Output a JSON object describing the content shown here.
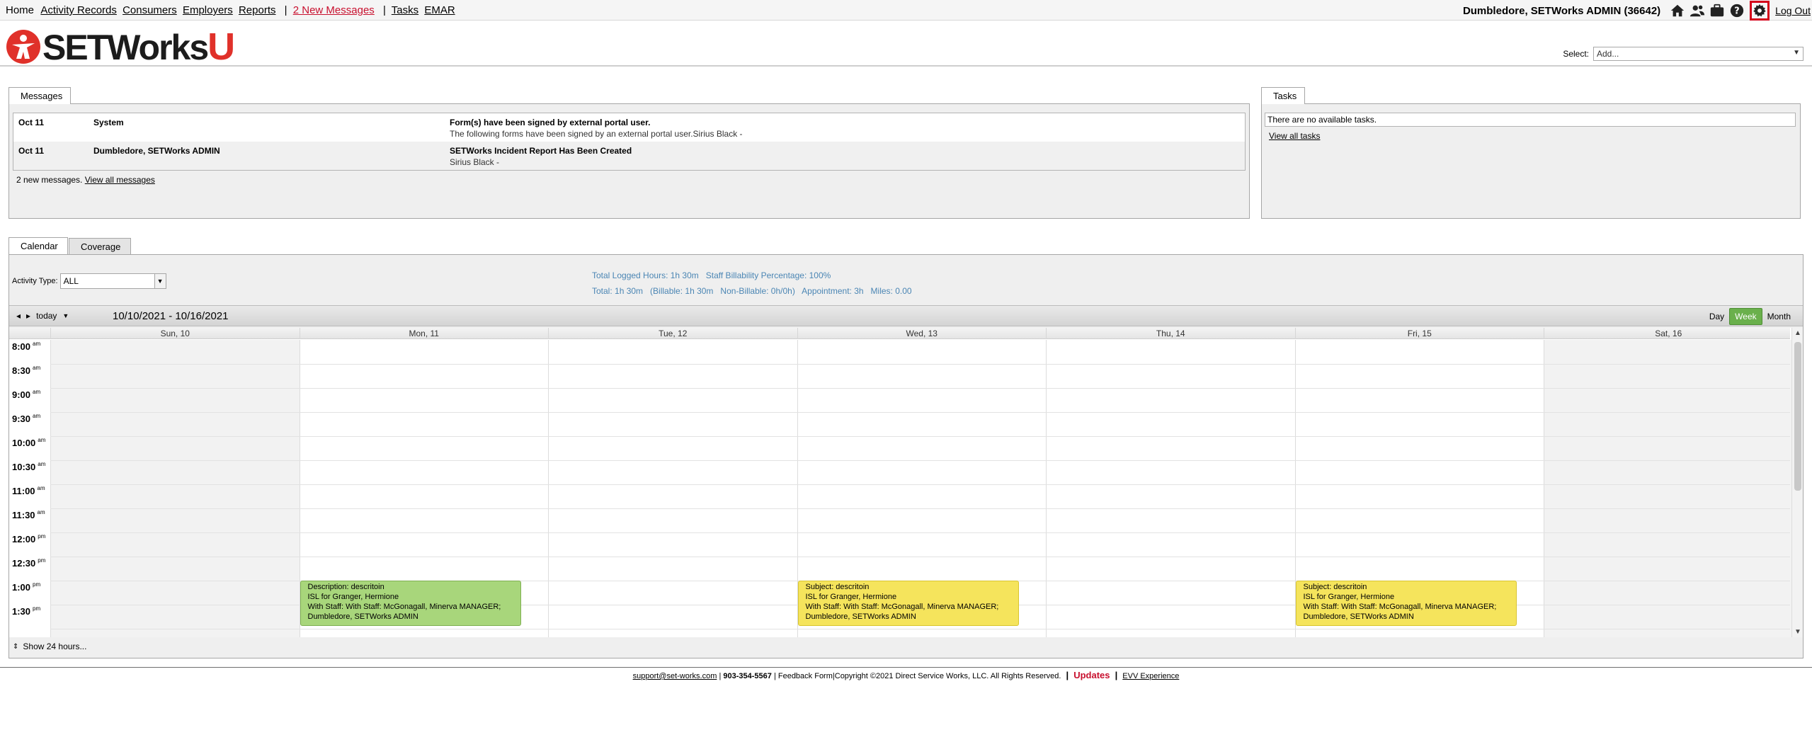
{
  "nav": {
    "home": "Home",
    "links": [
      "Activity Records",
      "Consumers",
      "Employers",
      "Reports"
    ],
    "messages": "2 New Messages",
    "tasks": "Tasks",
    "emar": "EMAR",
    "user": "Dumbledore,  SETWorks ADMIN  (36642)",
    "logout": "Log Out"
  },
  "logo": {
    "text": "SETWorks",
    "u": "U"
  },
  "quick_select": {
    "label": "Select:",
    "value": "Add..."
  },
  "messages": {
    "tab": "Messages",
    "rows": [
      {
        "date": "Oct 11",
        "from": "System",
        "subject": "Form(s) have been signed by external portal user.",
        "body": "The following forms have been signed by an external portal user.Sirius Black -"
      },
      {
        "date": "Oct 11",
        "from": "Dumbledore, SETWorks ADMIN",
        "subject": "SETWorks Incident Report Has Been Created",
        "body": "Sirius Black -"
      }
    ],
    "summary": "2 new messages.",
    "view_all": "View all messages"
  },
  "tasks": {
    "tab": "Tasks",
    "empty": "There are no available tasks.",
    "view_all": "View all tasks"
  },
  "calendar": {
    "tabs": [
      "Calendar",
      "Coverage"
    ],
    "activity_type_label": "Activity Type:",
    "activity_type_value": "ALL",
    "stats_line1": "Total Logged Hours: 1h 30m   Staff Billability Percentage: 100%",
    "stats_line2": "Total: 1h 30m   (Billable: 1h 30m   Non-Billable: 0h/0h)   Appointment: 3h   Miles: 0.00",
    "today": "today",
    "range": "10/10/2021 - 10/16/2021",
    "views": [
      "Day",
      "Week",
      "Month"
    ],
    "days": [
      "Sun, 10",
      "Mon, 11",
      "Tue, 12",
      "Wed, 13",
      "Thu, 14",
      "Fri, 15",
      "Sat, 16"
    ],
    "times": [
      {
        "t": "8:00",
        "p": "am"
      },
      {
        "t": "8:30",
        "p": "am"
      },
      {
        "t": "9:00",
        "p": "am"
      },
      {
        "t": "9:30",
        "p": "am"
      },
      {
        "t": "10:00",
        "p": "am"
      },
      {
        "t": "10:30",
        "p": "am"
      },
      {
        "t": "11:00",
        "p": "am"
      },
      {
        "t": "11:30",
        "p": "am"
      },
      {
        "t": "12:00",
        "p": "pm"
      },
      {
        "t": "12:30",
        "p": "pm"
      },
      {
        "t": "1:00",
        "p": "pm"
      },
      {
        "t": "1:30",
        "p": "pm"
      }
    ],
    "events": [
      {
        "day": 1,
        "color": "green",
        "lines": [
          "Description: descritoin",
          "ISL for Granger, Hermione",
          "With Staff: With Staff: McGonagall, Minerva MANAGER;",
          "Dumbledore, SETWorks ADMIN"
        ]
      },
      {
        "day": 3,
        "color": "yellow",
        "lines": [
          "Subject: descritoin",
          "ISL for Granger, Hermione",
          "With Staff: With Staff: McGonagall, Minerva MANAGER;",
          "Dumbledore, SETWorks ADMIN"
        ]
      },
      {
        "day": 5,
        "color": "yellow",
        "lines": [
          "Subject: descritoin",
          "ISL for Granger, Hermione",
          "With Staff: With Staff: McGonagall, Minerva MANAGER;",
          "Dumbledore, SETWorks ADMIN"
        ]
      }
    ],
    "show24": "Show 24 hours..."
  },
  "footer": {
    "email": "support@set-works.com",
    "phone": "903-354-5567",
    "copyright": "Feedback Form|Copyright ©2021 Direct Service Works, LLC. All Rights Reserved.",
    "updates": "Updates",
    "evv": "EVV Experience"
  }
}
